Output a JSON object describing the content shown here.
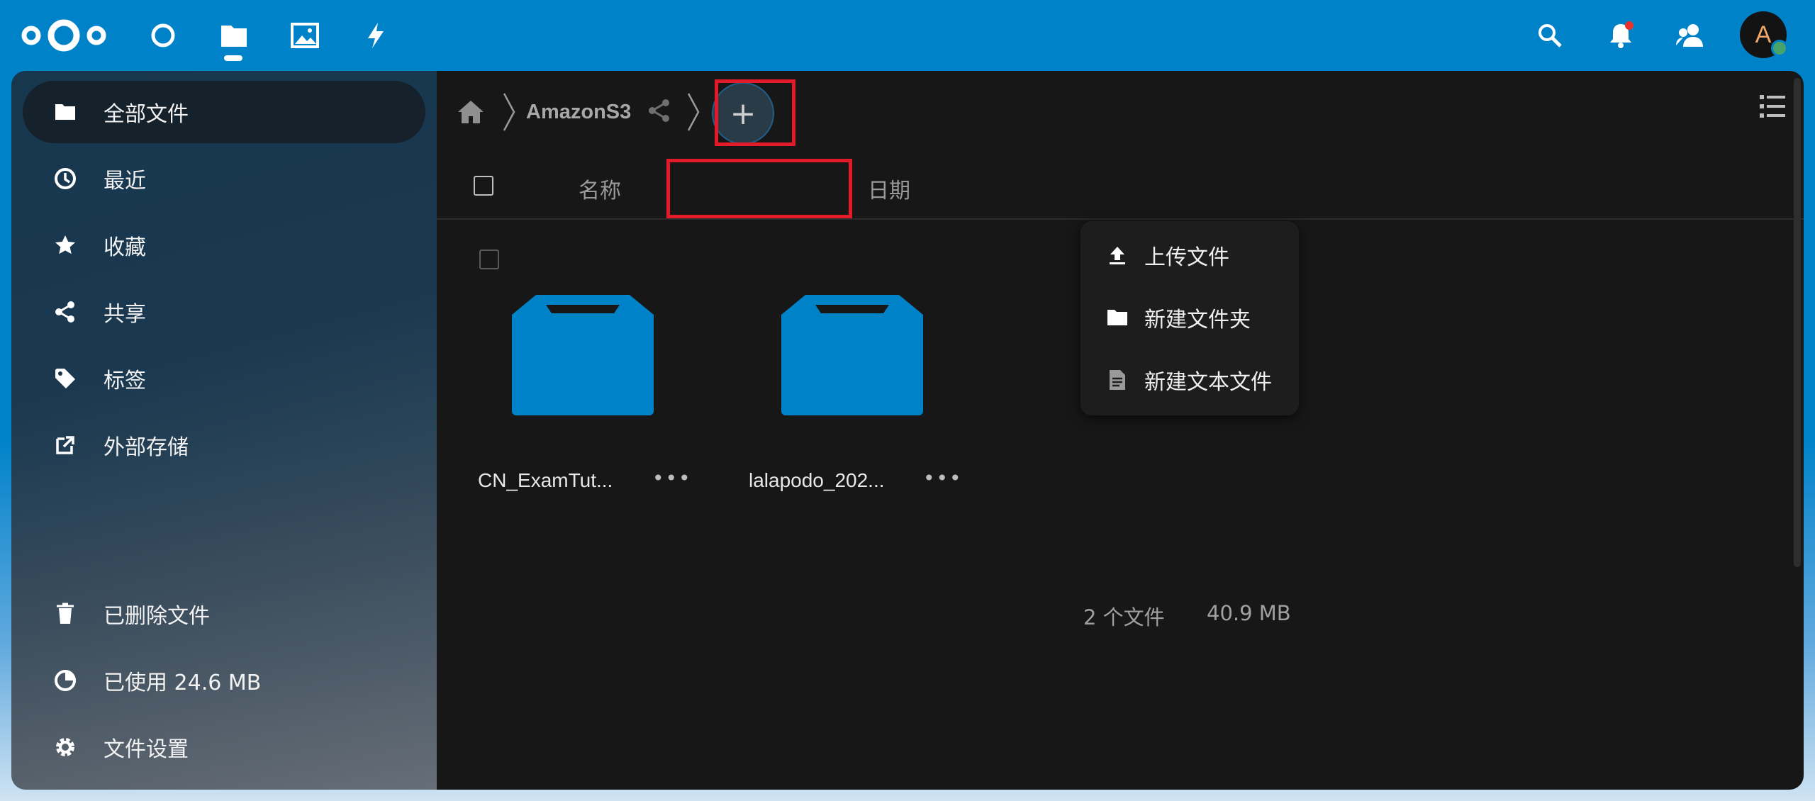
{
  "topbar": {
    "apps": [
      {
        "name": "dashboard"
      },
      {
        "name": "files"
      },
      {
        "name": "photos"
      },
      {
        "name": "activity"
      }
    ],
    "brand_color": "#0082c9",
    "avatar_letter": "A"
  },
  "sidebar": {
    "items": [
      {
        "label": "全部文件",
        "icon": "folder-icon"
      },
      {
        "label": "最近",
        "icon": "clock-icon"
      },
      {
        "label": "收藏",
        "icon": "star-icon"
      },
      {
        "label": "共享",
        "icon": "share-icon"
      },
      {
        "label": "标签",
        "icon": "tag-icon"
      },
      {
        "label": "外部存储",
        "icon": "external-link-icon"
      }
    ],
    "bottom": [
      {
        "label": "已删除文件",
        "icon": "trash-icon"
      },
      {
        "label": "已使用 24.6 MB",
        "icon": "pie-chart-icon"
      },
      {
        "label": "文件设置",
        "icon": "gear-icon"
      }
    ]
  },
  "breadcrumb": {
    "folder": "AmazonS3",
    "add_label": "+"
  },
  "table_header": {
    "name": "名称",
    "date": "日期"
  },
  "files": [
    {
      "name": "CN_ExamTut...",
      "more": "•••"
    },
    {
      "name": "lalapodo_202...",
      "more": "•••"
    }
  ],
  "summary": {
    "count": "2 个文件",
    "size": "40.9 MB"
  },
  "new_menu": {
    "items": [
      {
        "label": "上传文件",
        "icon": "upload-icon"
      },
      {
        "label": "新建文件夹",
        "icon": "folder-icon"
      },
      {
        "label": "新建文本文件",
        "icon": "text-file-icon"
      }
    ]
  },
  "highlight_color": "#e21a2a"
}
